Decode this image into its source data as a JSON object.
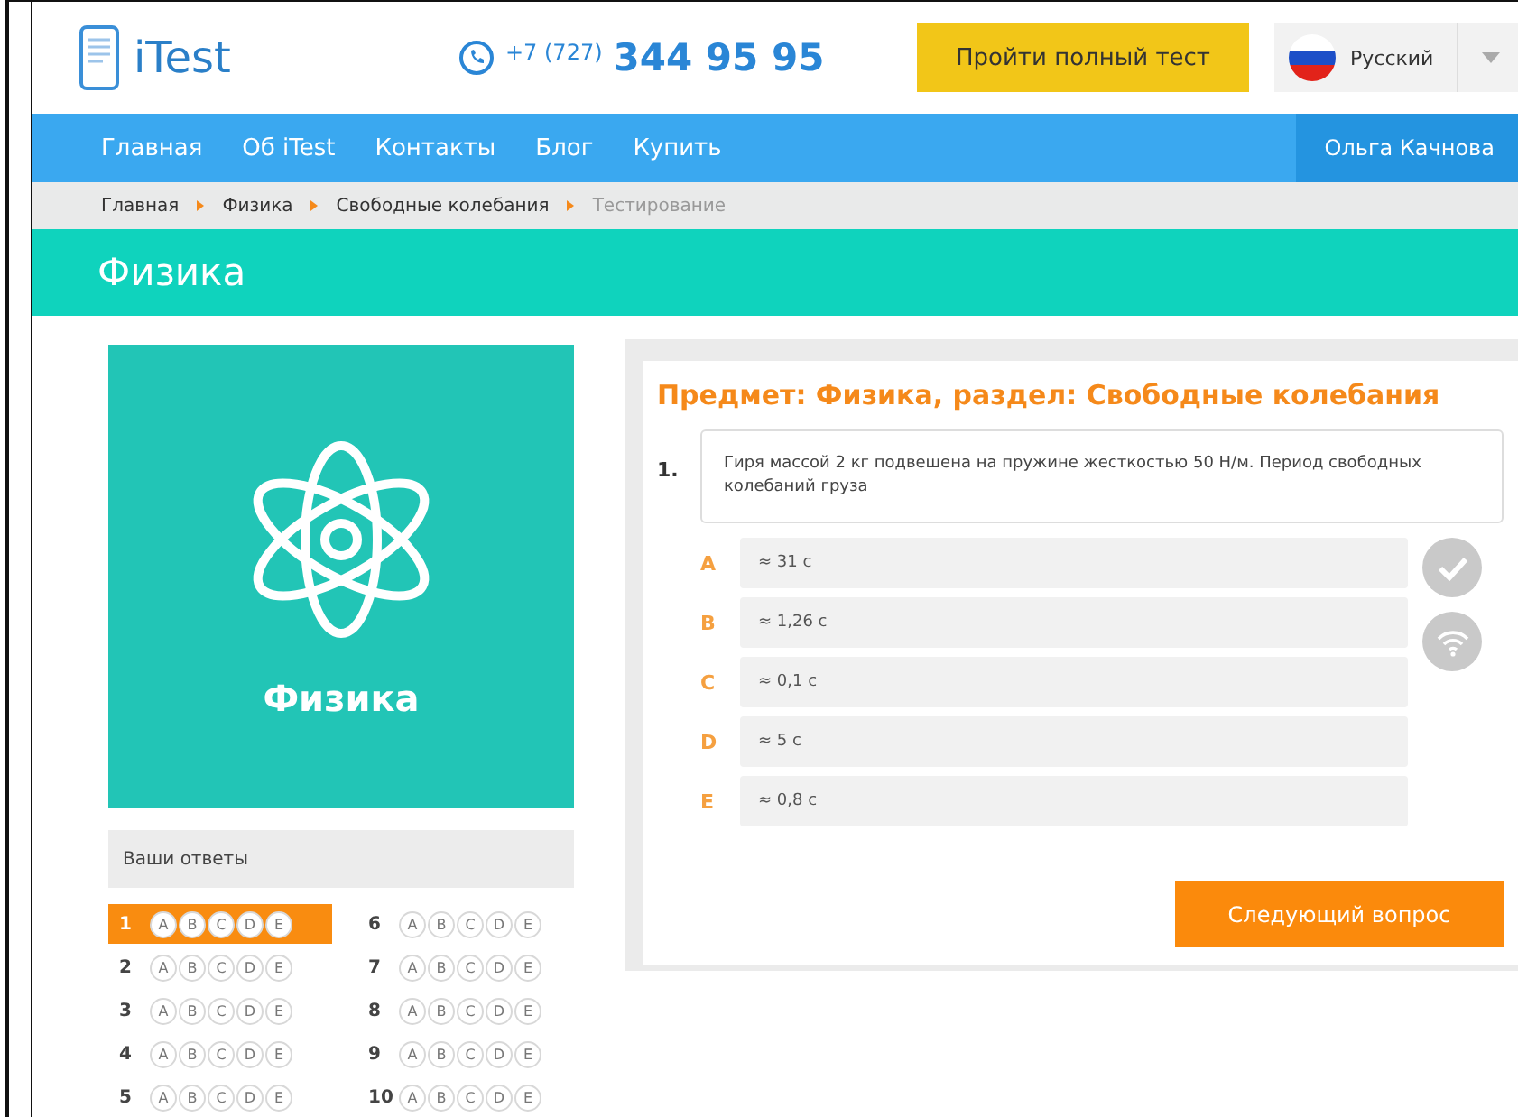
{
  "header": {
    "logo": "iTest",
    "phone_prefix": "+7 (727)",
    "phone_number": "344 95 95",
    "cta": "Пройти полный тест",
    "language": "Русский"
  },
  "nav": {
    "items": [
      "Главная",
      "Об iTest",
      "Контакты",
      "Блог",
      "Купить"
    ],
    "user": "Ольга Качнова"
  },
  "breadcrumbs": [
    {
      "label": "Главная",
      "current": false
    },
    {
      "label": "Физика",
      "current": false
    },
    {
      "label": "Свободные колебания",
      "current": false
    },
    {
      "label": "Тестирование",
      "current": true
    }
  ],
  "page_title": "Физика",
  "subject_card": {
    "title": "Физика"
  },
  "answers_panel": {
    "title": "Ваши ответы",
    "questions": [
      {
        "number": "1",
        "selected": true,
        "options": [
          "A",
          "B",
          "C",
          "D",
          "E"
        ]
      },
      {
        "number": "2",
        "selected": false,
        "options": [
          "A",
          "B",
          "C",
          "D",
          "E"
        ]
      },
      {
        "number": "3",
        "selected": false,
        "options": [
          "A",
          "B",
          "C",
          "D",
          "E"
        ]
      },
      {
        "number": "4",
        "selected": false,
        "options": [
          "A",
          "B",
          "C",
          "D",
          "E"
        ]
      },
      {
        "number": "5",
        "selected": false,
        "options": [
          "A",
          "B",
          "C",
          "D",
          "E"
        ]
      },
      {
        "number": "6",
        "selected": false,
        "options": [
          "A",
          "B",
          "C",
          "D",
          "E"
        ]
      },
      {
        "number": "7",
        "selected": false,
        "options": [
          "A",
          "B",
          "C",
          "D",
          "E"
        ]
      },
      {
        "number": "8",
        "selected": false,
        "options": [
          "A",
          "B",
          "C",
          "D",
          "E"
        ]
      },
      {
        "number": "9",
        "selected": false,
        "options": [
          "A",
          "B",
          "C",
          "D",
          "E"
        ]
      },
      {
        "number": "10",
        "selected": false,
        "options": [
          "A",
          "B",
          "C",
          "D",
          "E"
        ]
      }
    ]
  },
  "question": {
    "heading": "Предмет: Физика, раздел: Свободные колебания",
    "number": "1.",
    "text": "Гиря массой 2 кг подвешена на пружине жесткостью 50 Н/м. Период свободных колебаний груза",
    "options": [
      {
        "letter": "A",
        "text": "≈ 31 с"
      },
      {
        "letter": "B",
        "text": "≈ 1,26 с"
      },
      {
        "letter": "C",
        "text": "≈ 0,1 с"
      },
      {
        "letter": "D",
        "text": "≈ 5 с"
      },
      {
        "letter": "E",
        "text": "≈ 0,8 с"
      }
    ],
    "next_button": "Следующий вопрос"
  }
}
